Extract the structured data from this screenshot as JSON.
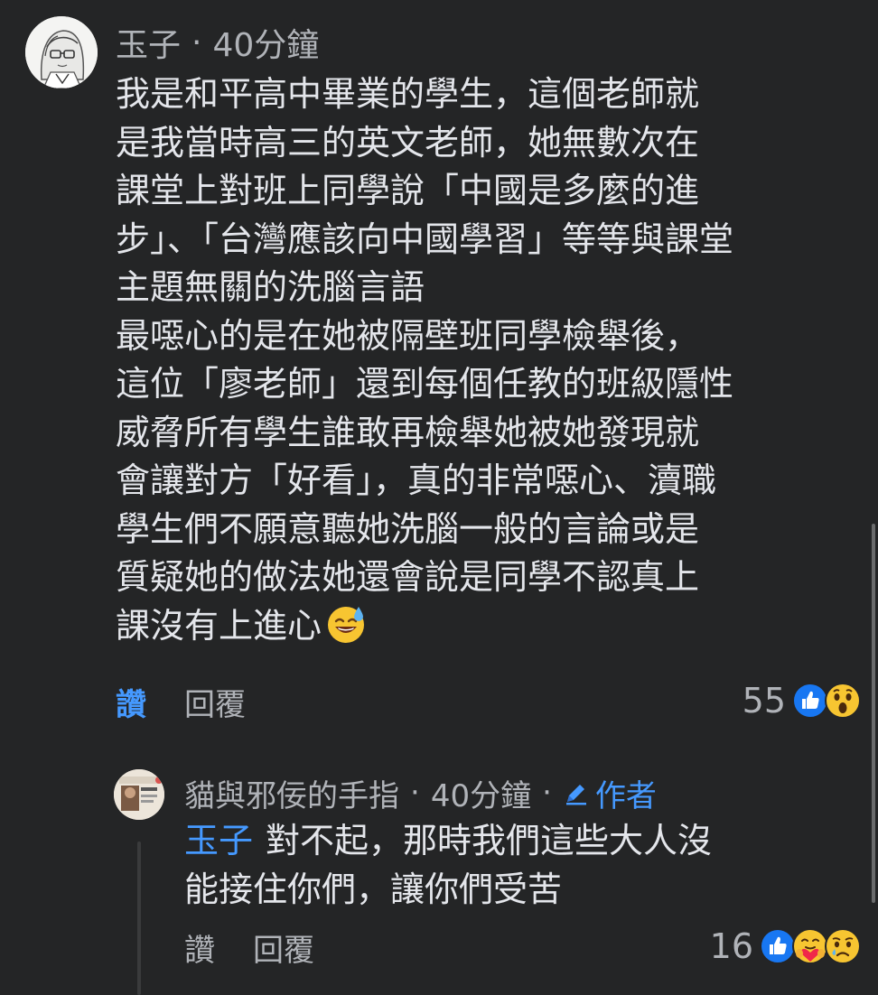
{
  "comment": {
    "author": "玉子",
    "separator": "·",
    "time": "40分鐘",
    "body_lines": [
      "我是和平高中畢業的學生，這個老師就",
      "是我當時高三的英文老師，她無數次在",
      "課堂上對班上同學說「中國是多麼的進",
      "步」、「台灣應該向中國學習」等等與課堂",
      "主題無關的洗腦言語",
      "最噁心的是在她被隔壁班同學檢舉後，",
      "這位「廖老師」還到每個任教的班級隱性",
      "威脅所有學生誰敢再檢舉她被她發現就",
      "會讓對方「好看」，真的非常噁心、瀆職",
      "學生們不願意聽她洗腦一般的言論或是",
      "質疑她的做法她還會說是同學不認真上",
      "課沒有上進心"
    ],
    "emoji": "sweat-smile-emoji",
    "like_label": "讚",
    "reply_label": "回覆",
    "reaction_count": "55",
    "reactions": [
      "like-icon",
      "wow-icon"
    ]
  },
  "reply": {
    "author": "貓與邪佞的手指",
    "separator": "·",
    "time": "40分鐘",
    "separator2": "·",
    "author_badge": "作者",
    "mention": "玉子",
    "body_line1": "對不起，那時我們這些大人沒",
    "body_line2": "能接住你們，讓你們受苦",
    "like_label": "讚",
    "reply_label": "回覆",
    "reaction_count": "16",
    "reactions": [
      "like-icon",
      "care-icon",
      "sad-icon"
    ]
  },
  "colors": {
    "background": "#242526",
    "text_primary": "#e4e6eb",
    "text_secondary": "#b0b3b8",
    "accent_blue": "#4599ff"
  }
}
